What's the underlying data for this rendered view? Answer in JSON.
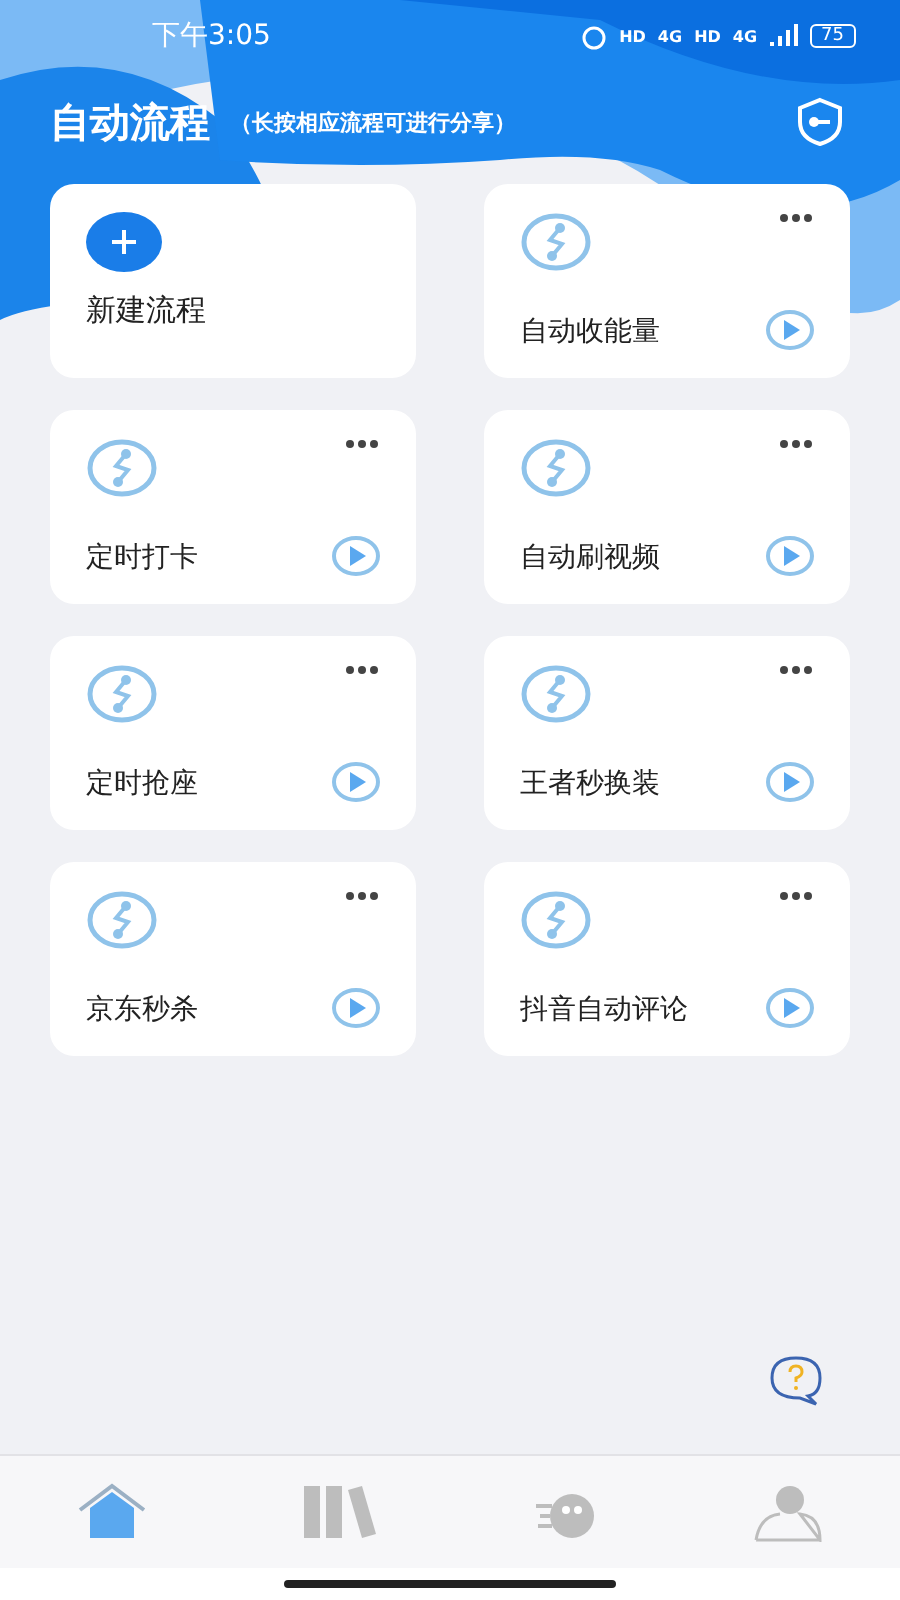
{
  "status_bar": {
    "time": "下午3:05",
    "network_badges": [
      "HD",
      "4G",
      "HD",
      "4G"
    ],
    "battery": "75"
  },
  "header": {
    "title": "自动流程",
    "hint": "（长按相应流程可进行分享）"
  },
  "flows": [
    {
      "kind": "create",
      "name": "新建流程"
    },
    {
      "kind": "flow",
      "name": "自动收能量"
    },
    {
      "kind": "flow",
      "name": "定时打卡"
    },
    {
      "kind": "flow",
      "name": "自动刷视频"
    },
    {
      "kind": "flow",
      "name": "定时抢座"
    },
    {
      "kind": "flow",
      "name": "王者秒换装"
    },
    {
      "kind": "flow",
      "name": "京东秒杀"
    },
    {
      "kind": "flow",
      "name": "抖音自动评论"
    }
  ],
  "tab_bar": [
    {
      "kind": "home",
      "selected": true
    },
    {
      "kind": "library",
      "selected": false
    },
    {
      "kind": "tools",
      "selected": false
    },
    {
      "kind": "profile",
      "selected": false
    }
  ]
}
